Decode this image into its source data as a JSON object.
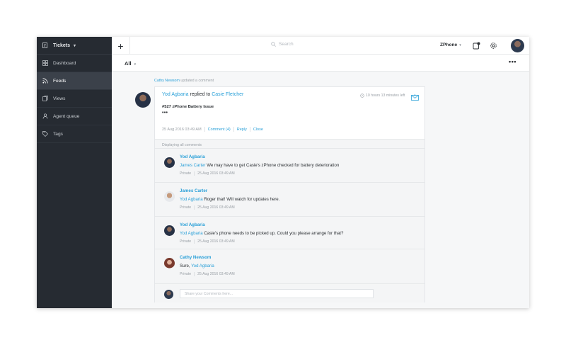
{
  "sidebar": {
    "top": {
      "label": "Tickets",
      "icon": "ticket-edit-icon"
    },
    "items": [
      {
        "label": "Dashboard",
        "icon": "grid-icon",
        "active": false
      },
      {
        "label": "Feeds",
        "icon": "rss-icon",
        "active": true
      },
      {
        "label": "Views",
        "icon": "views-icon",
        "active": false
      },
      {
        "label": "Agent queue",
        "icon": "agent-queue-icon",
        "active": false
      },
      {
        "label": "Tags",
        "icon": "tag-icon",
        "active": false
      }
    ]
  },
  "topbar": {
    "add_label": "+",
    "search_placeholder": "Search",
    "department": "ZPhone",
    "icons": [
      "notifications-icon",
      "settings-icon"
    ]
  },
  "subbar": {
    "filter": "All",
    "more": "•••"
  },
  "feed": {
    "activity_user": "Cathy Newsom",
    "activity_text": "updated a comment",
    "card": {
      "author": "Yod Agbaria",
      "action": "replied to",
      "target": "Casie Fletcher",
      "timer": "10 hours 13 minutes left",
      "ticket_title": "#527 zPhone Battery Issue",
      "body": "•••",
      "date": "25 Aug 2016 03:49 AM",
      "comment_link": "Comment (4)",
      "reply_link": "Reply",
      "close_link": "Close",
      "displaying": "Displaying all comments",
      "comments": [
        {
          "name": "Yod Agbaria",
          "mention": "James Carter",
          "text": "We may have to get Casie's zPhone checked for battery deterioration",
          "privacy": "Private",
          "date": "25 Aug 2016 03:49 AM"
        },
        {
          "name": "James Carter",
          "mention": "Yod Agbaria",
          "text": "Roger that! Will watch for updates here.",
          "privacy": "Private",
          "date": "25 Aug 2016 03:49 AM"
        },
        {
          "name": "Yod Agbaria",
          "mention": "Yod Agbaria",
          "text": "Casie's phone needs to be picked up. Could you please arrange for that?",
          "privacy": "Private",
          "date": "25 Aug 2016 03:49 AM"
        },
        {
          "name": "Cathy Newsom",
          "prefix": "Sure,",
          "mention": "Yod Agbaria",
          "privacy": "Private",
          "date": "25 Aug 2016 03:49 AM"
        }
      ],
      "share_placeholder": "Share your Comments here..."
    }
  },
  "colors": {
    "sidebar_bg": "#262b32",
    "accent": "#2aa0d8",
    "active_item": "#3b414a"
  }
}
